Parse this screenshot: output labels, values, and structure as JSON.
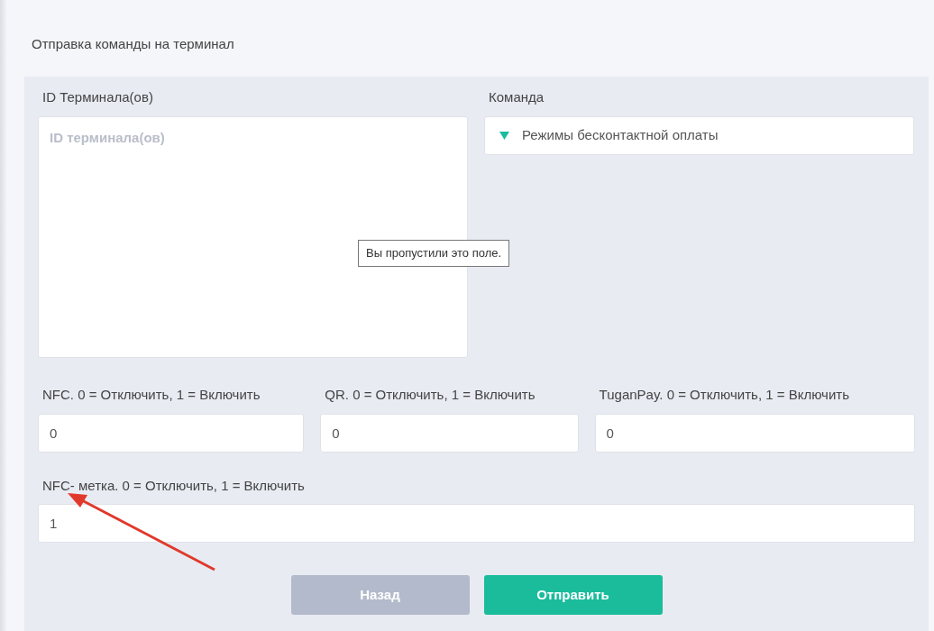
{
  "title": "Отправка команды на терминал",
  "terminal_ids": {
    "label": "ID Терминала(ов)",
    "placeholder": "ID терминала(ов)"
  },
  "command": {
    "label": "Команда",
    "value": "Режимы бесконтактной оплаты"
  },
  "tooltip": "Вы пропустили это поле.",
  "params": [
    {
      "label": "NFC. 0 = Отключить, 1 = Включить",
      "value": "0"
    },
    {
      "label": "QR. 0 = Отключить, 1 = Включить",
      "value": "0"
    },
    {
      "label": "TuganPay. 0 = Отключить, 1 = Включить",
      "value": "0"
    },
    {
      "label": "NFC- метка. 0 = Отключить, 1 = Включить",
      "value": "1"
    }
  ],
  "buttons": [
    {
      "label": "Назад",
      "kind": "secondary"
    },
    {
      "label": "Отправить",
      "kind": "primary"
    }
  ]
}
